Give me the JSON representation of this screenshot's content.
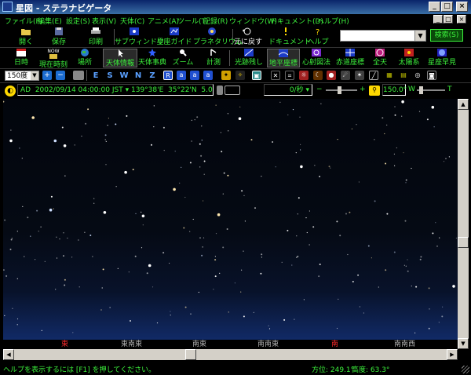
{
  "window": {
    "title": "星図 - ステラナビゲータ",
    "controls": [
      "_",
      "□",
      "×"
    ]
  },
  "menu": [
    "ファイル(F)",
    "編集(E)",
    "設定(S)",
    "表示(V)",
    "天体(C)",
    "アニメ(A)",
    "ツール(T)",
    "記録(R)",
    "ウィンドウ(W)",
    "ドキュメント(D)",
    "ヘルプ(H)"
  ],
  "toolbar1": {
    "open": "開く",
    "save": "保存",
    "print": "印刷",
    "subwindow": "サブウィンドウ",
    "constellation_guide": "星座ガイド",
    "planetarium": "プラネタリウム",
    "undo": "元に戻す",
    "document": "ドキュメント",
    "help": "ヘルプ",
    "search_button": "検索(S)",
    "search_value": "",
    "now_badge": "NOW"
  },
  "toolbar2": {
    "datetime": "日時",
    "now": "現在時刻",
    "place": "場所",
    "object_info": "天体情報",
    "object_event": "天体事典",
    "zoom": "ズーム",
    "measure": "計測",
    "trail": "光跡残し",
    "horizon_coords": "地平座標",
    "projection": "心射図法",
    "equatorial_coords": "赤道座標",
    "allsky": "全天",
    "solar_system": "太陽系",
    "constellation_early": "星座早見"
  },
  "toolbar3": {
    "fov": "150度",
    "directions": [
      "E",
      "S",
      "W",
      "N",
      "Z"
    ],
    "modes": [
      "R",
      "a",
      "a",
      "a"
    ]
  },
  "timebar": {
    "era": "AD",
    "datetime": "2002/09/14 04:00:00 JST",
    "longitude": "139°38'E",
    "latitude": "35°22'N",
    "magnitude": "5.0",
    "speed": "0/秒",
    "fov_value": "150.0°",
    "w_label": "W",
    "t_label": "T"
  },
  "horizon_labels": [
    {
      "text": "東",
      "color": "#ff2a2a"
    },
    {
      "text": "東南東",
      "color": "#b4b4b4"
    },
    {
      "text": "南東",
      "color": "#b4b4b4"
    },
    {
      "text": "南南東",
      "color": "#b4b4b4"
    },
    {
      "text": "南",
      "color": "#ff2a2a"
    },
    {
      "text": "南南西",
      "color": "#b4b4b4"
    }
  ],
  "status": {
    "help": "ヘルプを表示するには [F1] を押してください。",
    "azimuth": "方位: 249.1°",
    "altitude": "高度: 63.3°"
  },
  "colors": {
    "accent": "#3cf03c",
    "title_bar": "#0a246a",
    "sky": "#02050c",
    "horizon_red": "#ff2a2a"
  }
}
